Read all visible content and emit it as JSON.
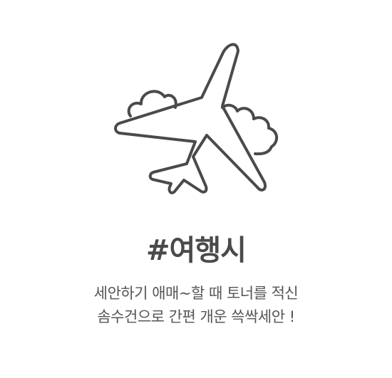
{
  "heading": {
    "title": "#여행시"
  },
  "description": {
    "line1": "세안하기 애매~할 때 토너를 적신",
    "line2": "솜수건으로 간편 개운 쓱싹세안 !"
  },
  "illustration": {
    "icon": "airplane-with-clouds-icon",
    "stroke_color": "#4a4a4a"
  }
}
